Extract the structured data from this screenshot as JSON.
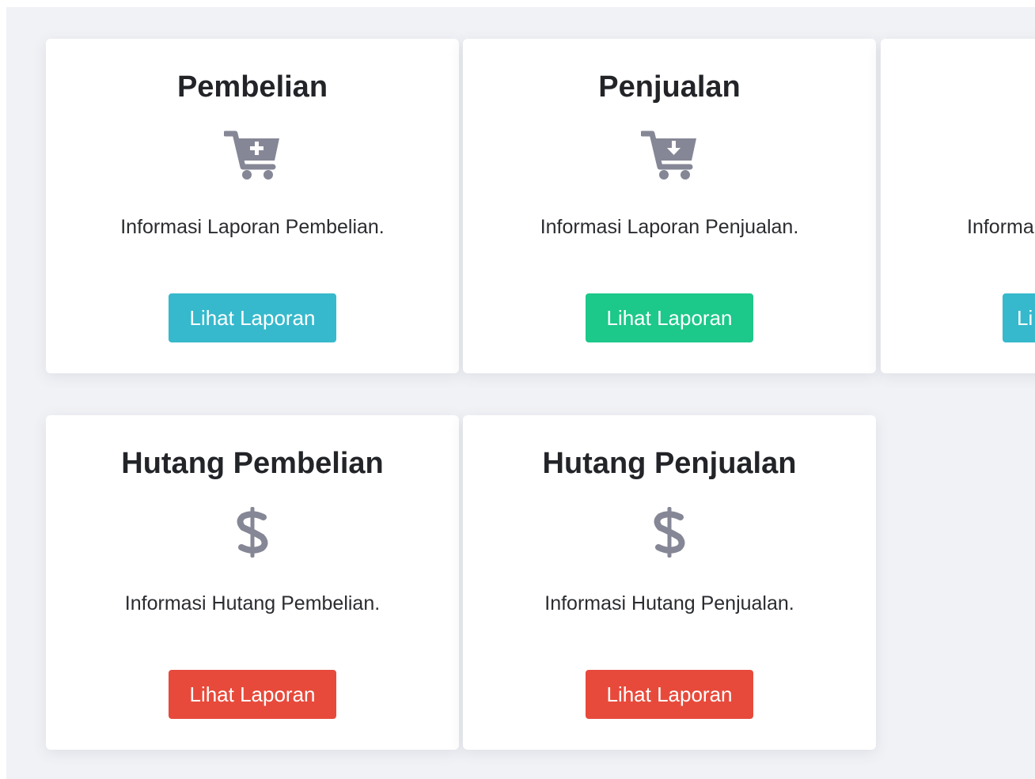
{
  "cards": [
    {
      "title": "Pembelian",
      "icon": "cart-plus-icon",
      "description": "Informasi Laporan Pembelian.",
      "button_label": "Lihat Laporan",
      "button_color": "#36b9cc"
    },
    {
      "title": "Penjualan",
      "icon": "cart-arrow-down-icon",
      "description": "Informasi Laporan Penjualan.",
      "button_label": "Lihat Laporan",
      "button_color": "#1cc88a"
    },
    {
      "title": "",
      "icon": "",
      "description": "Informa",
      "button_label": "Li",
      "button_color": "#36b9cc"
    },
    {
      "title": "Hutang Pembelian",
      "icon": "dollar-sign-icon",
      "description": "Informasi Hutang Pembelian.",
      "button_label": "Lihat Laporan",
      "button_color": "#e74a3b"
    },
    {
      "title": "Hutang Penjualan",
      "icon": "dollar-sign-icon",
      "description": "Informasi Hutang Penjualan.",
      "button_label": "Lihat Laporan",
      "button_color": "#e74a3b"
    }
  ],
  "colors": {
    "background": "#f1f2f6",
    "card": "#ffffff",
    "icon": "#858796",
    "title": "#222428"
  }
}
